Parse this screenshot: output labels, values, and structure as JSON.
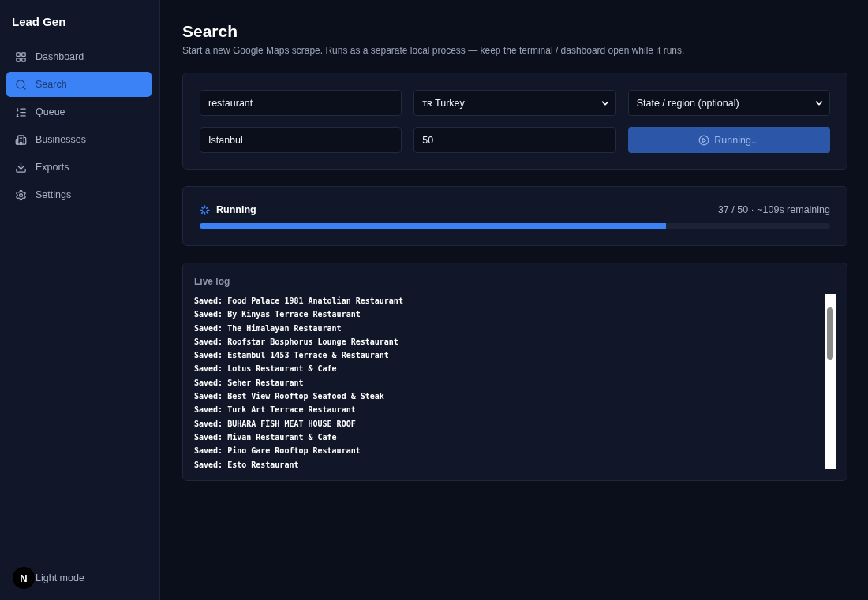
{
  "sidebar": {
    "title": "Lead Gen",
    "items": [
      {
        "label": "Dashboard",
        "selected": false
      },
      {
        "label": "Search",
        "selected": true
      },
      {
        "label": "Queue",
        "selected": false
      },
      {
        "label": "Businesses",
        "selected": false
      },
      {
        "label": "Exports",
        "selected": false
      },
      {
        "label": "Settings",
        "selected": false
      }
    ],
    "theme_toggle": "Light mode",
    "dev_badge": "N"
  },
  "page": {
    "title": "Search",
    "subtitle": "Start a new Google Maps scrape. Runs as a separate local process — keep the terminal / dashboard open while it runs."
  },
  "form": {
    "fields": [
      {
        "kind": "input",
        "value": "restaurant"
      },
      {
        "kind": "select",
        "value": "ᴛʀ Turkey"
      },
      {
        "kind": "select",
        "value": "State / region (optional)"
      },
      {
        "kind": "input",
        "value": "Istanbul"
      },
      {
        "kind": "input",
        "value": "50"
      }
    ],
    "run_button": {
      "label": "Running...",
      "disabled": true
    }
  },
  "progress": {
    "status": "Running",
    "count": "37 / 50 · ~109s remaining",
    "level": 0.74
  },
  "log": {
    "title": "Live log",
    "lines": [
      "Saved: Food Palace 1981 Anatolian Restaurant",
      "Saved: By Kinyas Terrace Restaurant",
      "Saved: The Himalayan Restaurant",
      "Saved: Roofstar Bosphorus Lounge Restaurant",
      "Saved: Estambul 1453 Terrace & Restaurant",
      "Saved: Lotus Restaurant & Cafe",
      "Saved: Seher Restaurant",
      "Saved: Best View Rooftop Seafood & Steak",
      "Saved: Turk Art Terrace Restaurant",
      "Saved: BUHARA FİSH MEAT HOUSE ROOF",
      "Saved: Mivan Restaurant & Cafe",
      "Saved: Pino Gare Rooftop Restaurant",
      "Saved: Esto Restaurant"
    ]
  }
}
